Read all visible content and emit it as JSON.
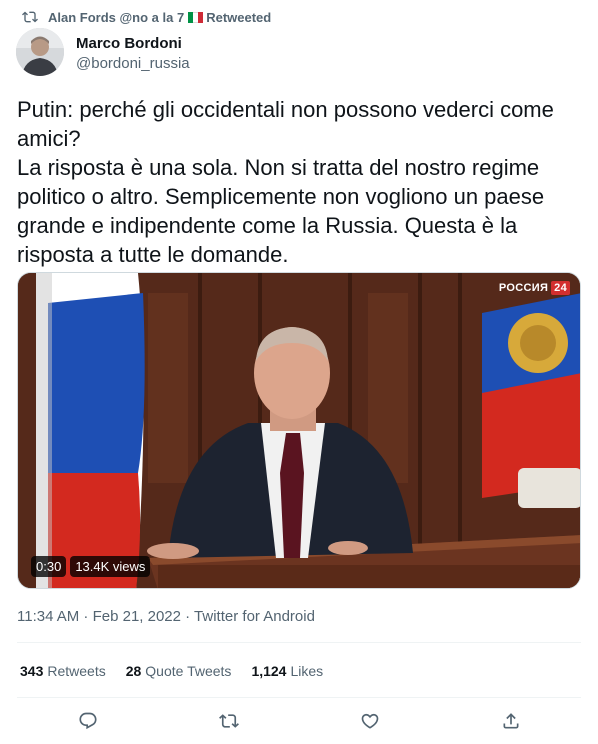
{
  "retweet_header": {
    "user": "Alan Fords @no a la 7",
    "flag_colors": [
      "#009246",
      "#ffffff",
      "#ce2b37"
    ],
    "label": "Retweeted",
    "icon": "retweet-icon"
  },
  "author": {
    "display_name": "Marco Bordoni",
    "handle": "@bordoni_russia"
  },
  "tweet": {
    "text": "Putin: perché gli occidentali non possono vederci come amici?\nLa risposta è una sola. Non si tratta del nostro regime politico o altro. Semplicemente non vogliono un paese grande e indipendente come la Russia. Questa è la risposta a tutte le domande."
  },
  "media": {
    "channel_name": "РОССИЯ",
    "channel_number": "24",
    "duration": "0:30",
    "views": "13.4K views"
  },
  "meta": {
    "line": "11:34 AM · Feb 21, 2022 · Twitter for Android"
  },
  "stats": {
    "retweets_count": "343",
    "retweets_label": "Retweets",
    "quotes_count": "28",
    "quotes_label": "Quote Tweets",
    "likes_count": "1,124",
    "likes_label": "Likes"
  },
  "actions": [
    "reply-icon",
    "retweet-icon",
    "like-icon",
    "share-icon"
  ],
  "colors": {
    "text_primary": "#0f1419",
    "text_secondary": "#536471",
    "divider": "#eff3f4"
  }
}
